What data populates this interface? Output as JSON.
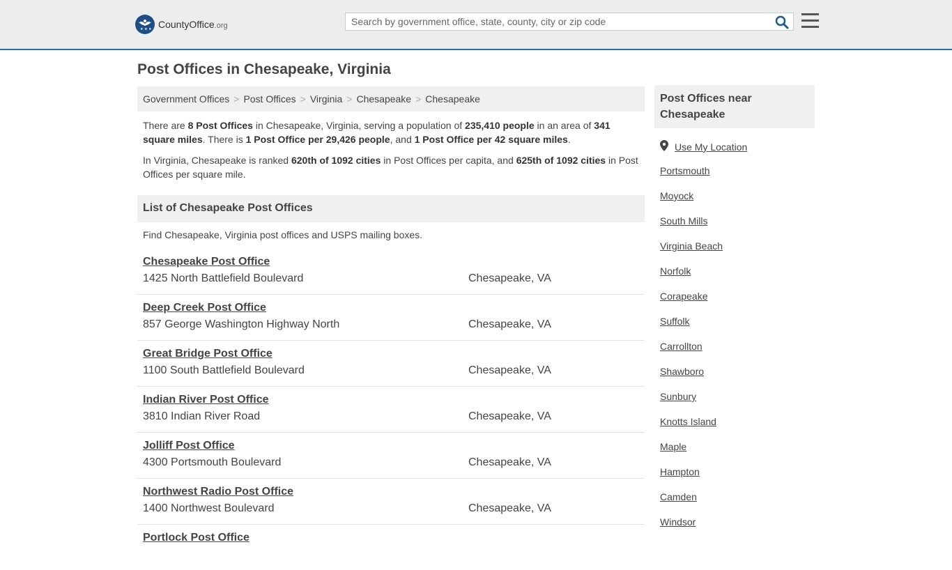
{
  "header": {
    "logo_text": "CountyOffice",
    "logo_suffix": ".org",
    "search_placeholder": "Search by government office, state, county, city or zip code"
  },
  "page": {
    "title": "Post Offices in Chesapeake, Virginia"
  },
  "breadcrumb": [
    "Government Offices",
    "Post Offices",
    "Virginia",
    "Chesapeake",
    "Chesapeake"
  ],
  "summary": {
    "p1_a": "There are ",
    "p1_b": "8 Post Offices",
    "p1_c": " in Chesapeake, Virginia, serving a population of ",
    "p1_d": "235,410 people",
    "p1_e": " in an area of ",
    "p1_f": "341 square miles",
    "p1_g": ". There is ",
    "p1_h": "1 Post Office per 29,426 people",
    "p1_i": ", and ",
    "p1_j": "1 Post Office per 42 square miles",
    "p1_k": ".",
    "p2_a": "In Virginia, Chesapeake is ranked ",
    "p2_b": "620th of 1092 cities",
    "p2_c": " in Post Offices per capita, and ",
    "p2_d": "625th of 1092 cities",
    "p2_e": " in Post Offices per square mile."
  },
  "list": {
    "header": "List of Chesapeake Post Offices",
    "intro": "Find Chesapeake, Virginia post offices and USPS mailing boxes.",
    "offices": [
      {
        "name": "Chesapeake Post Office",
        "address": "1425 North Battlefield Boulevard",
        "city": "Chesapeake, VA"
      },
      {
        "name": "Deep Creek Post Office",
        "address": "857 George Washington Highway North",
        "city": "Chesapeake, VA"
      },
      {
        "name": "Great Bridge Post Office",
        "address": "1100 South Battlefield Boulevard",
        "city": "Chesapeake, VA"
      },
      {
        "name": "Indian River Post Office",
        "address": "3810 Indian River Road",
        "city": "Chesapeake, VA"
      },
      {
        "name": "Jolliff Post Office",
        "address": "4300 Portsmouth Boulevard",
        "city": "Chesapeake, VA"
      },
      {
        "name": "Northwest Radio Post Office",
        "address": "1400 Northwest Boulevard",
        "city": "Chesapeake, VA"
      },
      {
        "name": "Portlock Post Office",
        "address": "",
        "city": ""
      }
    ]
  },
  "sidebar": {
    "header": "Post Offices near Chesapeake",
    "use_location": "Use My Location",
    "nearby": [
      "Portsmouth",
      "Moyock",
      "South Mills",
      "Virginia Beach",
      "Norfolk",
      "Corapeake",
      "Suffolk",
      "Carrollton",
      "Shawboro",
      "Sunbury",
      "Knotts Island",
      "Maple",
      "Hampton",
      "Camden",
      "Windsor"
    ]
  }
}
